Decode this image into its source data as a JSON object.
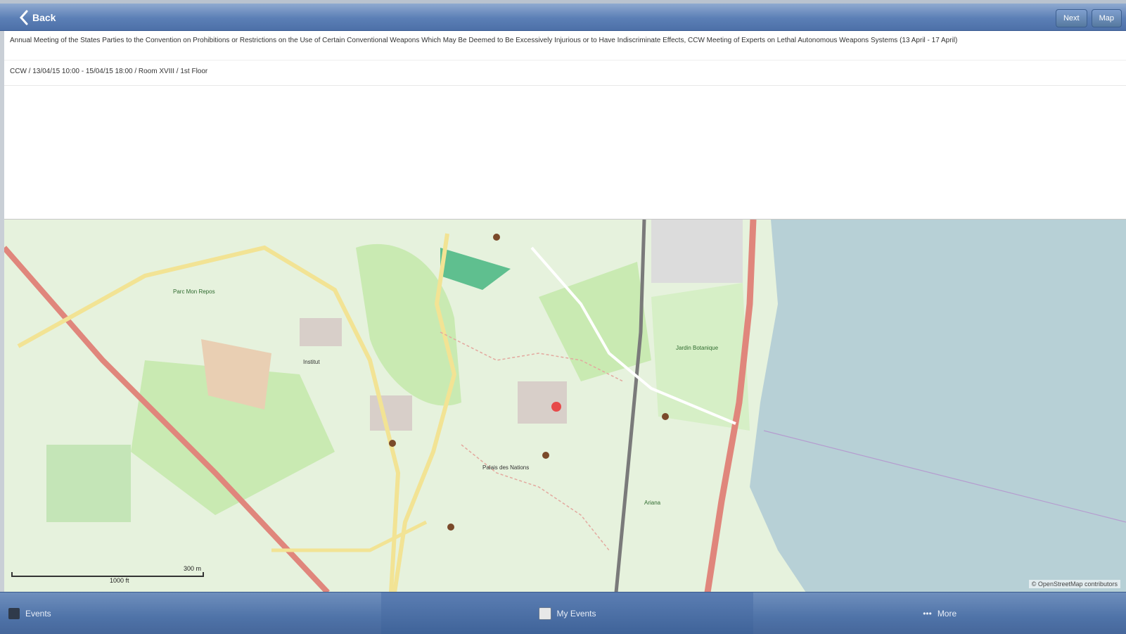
{
  "header": {
    "back_label": "Back",
    "nav_buttons": [
      "Next",
      "Map"
    ]
  },
  "meeting": {
    "title": "Annual Meeting of the States Parties to the Convention on Prohibitions or Restrictions on the Use of Certain Conventional Weapons Which May Be Deemed to Be Excessively Injurious or to Have Indiscriminate Effects, CCW Meeting of Experts on Lethal Autonomous Weapons Systems (13 April - 17 April)",
    "details": "CCW / 13/04/15 10:00 - 15/04/15 18:00 / Room XVIII / 1st Floor"
  },
  "map": {
    "attribution": "© OpenStreetMap contributors",
    "scale_labels": [
      "300 m",
      "1000 ft"
    ],
    "labels": [
      "Jardin Botanique",
      "Parc Mon Repos",
      "Palais des Nations",
      "Ariana",
      "Institut"
    ],
    "colors": {
      "land": "#e6f2dd",
      "park": "#c9eab2",
      "water": "#b7d0d6",
      "road_major": "#e0867c",
      "road_secondary": "#f2e394",
      "building": "#d8cfc9",
      "rail": "#7a7a7a",
      "marker": "#e74a4a"
    }
  },
  "tabbar": {
    "tabs": [
      "Events",
      "My Events",
      "More"
    ],
    "active_index": 1
  }
}
